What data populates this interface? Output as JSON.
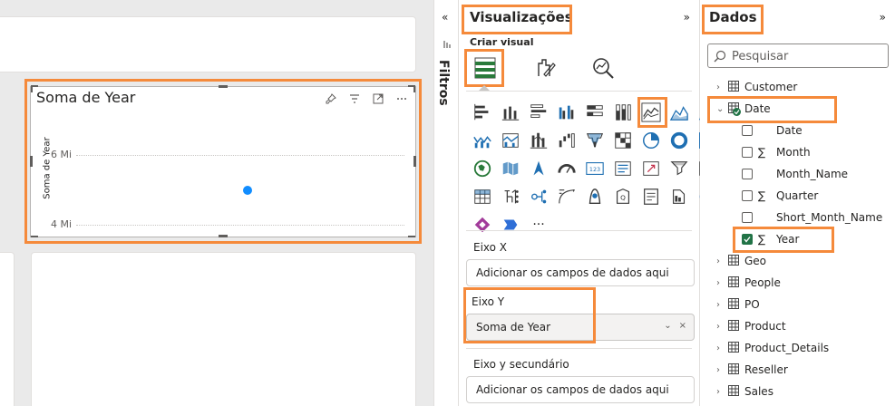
{
  "visual": {
    "title": "Soma de Year",
    "y_axis_label": "Soma de Year",
    "ticks": [
      "6 Mi",
      "4 Mi"
    ],
    "header_icons": [
      "pin-icon",
      "filter-icon",
      "focus-mode-icon",
      "more-options-icon"
    ]
  },
  "chart_data": {
    "type": "scatter",
    "title": "Soma de Year",
    "ylabel": "Soma de Year",
    "y_ticks": [
      "6 Mi",
      "4 Mi"
    ],
    "series": [
      {
        "values": [
          5000000
        ]
      }
    ]
  },
  "filters_pane": {
    "label": "Filtros"
  },
  "visualizations": {
    "title": "Visualizações",
    "build_visual_label": "Criar visual",
    "icons": [
      "stacked-bar-icon",
      "stacked-column-icon",
      "clustered-bar-icon",
      "clustered-column-icon",
      "100-stacked-bar-icon",
      "100-stacked-column-icon",
      "line-chart-icon",
      "area-chart-icon",
      "stacked-area-icon",
      "line-stacked-column-icon",
      "line-clustered-column-icon",
      "ribbon-chart-icon",
      "waterfall-icon",
      "funnel-icon",
      "scatter-icon",
      "pie-chart-icon",
      "donut-chart-icon",
      "treemap-icon",
      "map-icon",
      "filled-map-icon",
      "azure-map-icon",
      "gauge-icon",
      "card-icon",
      "multi-row-card-icon",
      "kpi-icon",
      "slicer-icon",
      "table-icon",
      "matrix-icon",
      "r-visual-icon",
      "python-visual-icon",
      "key-influencers-icon",
      "decomposition-tree-icon",
      "qa-icon",
      "smart-narrative-icon",
      "paginated-report-icon",
      "arcgis-map-icon",
      "power-apps-icon",
      "power-automate-icon",
      "more-visuals-icon"
    ],
    "more_label": "···",
    "x_axis": {
      "label": "Eixo X",
      "placeholder": "Adicionar os campos de dados aqui"
    },
    "y_axis": {
      "label": "Eixo Y",
      "field": "Soma de Year"
    },
    "secondary_y": {
      "label": "Eixo y secundário",
      "placeholder": "Adicionar os campos de dados aqui"
    }
  },
  "data_pane": {
    "title": "Dados",
    "search_placeholder": "Pesquisar",
    "tables_top": [
      "Customer",
      "Date"
    ],
    "date_fields": [
      {
        "name": "Date",
        "sigma": false,
        "checked": false
      },
      {
        "name": "Month",
        "sigma": true,
        "checked": false
      },
      {
        "name": "Month_Name",
        "sigma": false,
        "checked": false
      },
      {
        "name": "Quarter",
        "sigma": true,
        "checked": false
      },
      {
        "name": "Short_Month_Name",
        "sigma": false,
        "checked": false
      },
      {
        "name": "Year",
        "sigma": true,
        "checked": true
      }
    ],
    "tables_bottom": [
      "Geo",
      "People",
      "PO",
      "Product",
      "Product_Details",
      "Reseller",
      "Sales"
    ],
    "sigma_symbol": "∑",
    "expand_symbol": "›",
    "collapse_symbol": "⌄"
  },
  "colors": {
    "highlight": "#f58a3b",
    "accent": "#118dff",
    "checked": "#217346"
  }
}
